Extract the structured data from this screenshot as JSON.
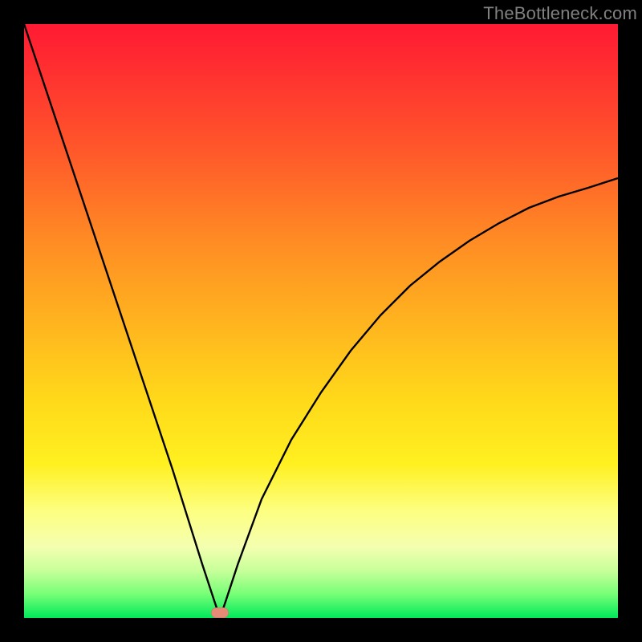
{
  "watermark": "TheBottleneck.com",
  "colors": {
    "background": "#000000",
    "watermark_text": "#808080",
    "curve_stroke": "#000000",
    "marker_fill": "#e78b77",
    "gradient_stops": [
      "#ff1a33",
      "#ff5a2a",
      "#ffb31f",
      "#fff020",
      "#f4ffb0",
      "#00e85a"
    ]
  },
  "chart_data": {
    "type": "line",
    "title": "",
    "xlabel": "",
    "ylabel": "",
    "xlim": [
      0,
      100
    ],
    "ylim": [
      0,
      100
    ],
    "grid": false,
    "legend": false,
    "annotation": "V-shaped bottleneck curve with minimum near x≈33; steep linear descent on the left, slower concave ascent on the right.",
    "minimum": {
      "x": 33,
      "y": 0
    },
    "series": [
      {
        "name": "bottleneck-curve",
        "x": [
          0,
          5,
          10,
          15,
          20,
          25,
          30,
          32,
          33,
          34,
          36,
          40,
          45,
          50,
          55,
          60,
          65,
          70,
          75,
          80,
          85,
          90,
          95,
          100
        ],
        "values": [
          100,
          85,
          70,
          55,
          40,
          25,
          9,
          3,
          0,
          3,
          9,
          20,
          30,
          38,
          45,
          51,
          56,
          60,
          63.5,
          66.5,
          69,
          71,
          72.5,
          74
        ]
      }
    ],
    "markers": [
      {
        "name": "minimum-marker",
        "x": 33,
        "y": 0
      }
    ]
  }
}
